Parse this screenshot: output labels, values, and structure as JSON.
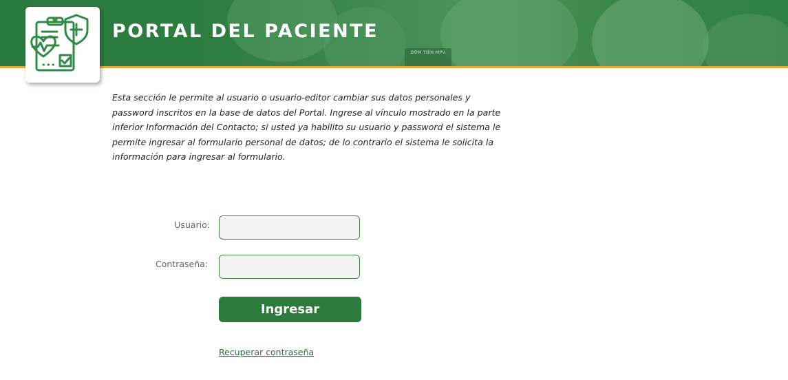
{
  "header": {
    "title": "PORTAL DEL PACIENTE",
    "logo_icon": "medical-record-heart-shield-icon",
    "background_sign": "BƠM TIÊN MPV",
    "colors": {
      "banner": "#2e7d41",
      "accent_line": "#e0a93a"
    }
  },
  "intro": {
    "text": "Esta sección le permite al usuario o usuario-editor cambiar sus datos personales y\npassword inscritos en la base de datos del Portal. Ingrese al vínculo mostrado en la parte\ninferior Información del Contacto; si usted ya habilito su usuario y password el sistema le\npermite ingresar al formulario personal de datos; de lo contrario el sistema le solicita la\ninformación para ingresar al formulario."
  },
  "login": {
    "username_label": "Usuario:",
    "username_value": "",
    "password_label": "Contraseña:",
    "password_value": "",
    "submit_label": "Ingresar",
    "recover_link": "Recuperar contraseña",
    "colors": {
      "button": "#2c7a3c",
      "field_border": "#3d8a3d"
    }
  }
}
